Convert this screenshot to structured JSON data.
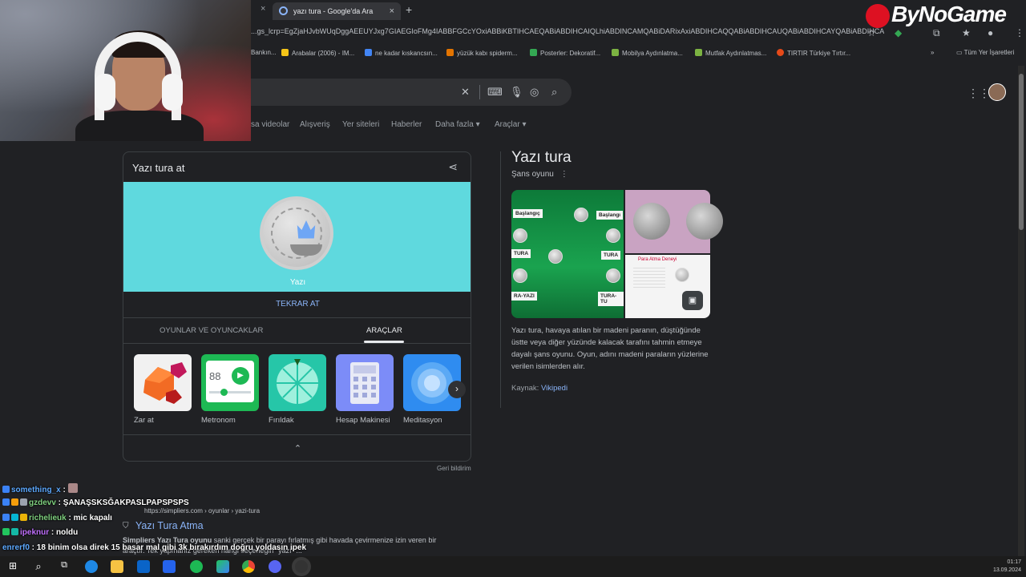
{
  "browser": {
    "tab_prev_close": "×",
    "tab_title": "yazı tura - Google'da Ara",
    "tab_close": "×",
    "new_tab": "+",
    "url": "...gs_lcrp=EgZjaHJvbWUqDggAEEUYJxg7GIAEGIoFMg4IABBFGCcYOxiABBiKBTIHCAEQABiABDIHCAIQLhiABDINCAMQABiDARixAxiABDIHCAQQABiABDIHCAUQABiABDIHCAYQABiABDIHCA...",
    "bookmarks": [
      {
        "label": "Bankın...",
        "color": "#4a4a4a"
      },
      {
        "label": "Arabalar (2006) - IM...",
        "color": "#f5c518"
      },
      {
        "label": "ne kadar kıskancsın...",
        "color": "#4285f4"
      },
      {
        "label": "yüzük kabı spiderm...",
        "color": "#e37400"
      },
      {
        "label": "Posterler: Dekoratif...",
        "color": "#34a853"
      },
      {
        "label": "Mobilya Aydınlatma...",
        "color": "#7cb342"
      },
      {
        "label": "Mutfak Aydınlatmas...",
        "color": "#7cb342"
      },
      {
        "label": "TIRTIR Türkiye Tırtır...",
        "color": "#e64a19"
      }
    ],
    "bookmarks_more": "»",
    "bookmarks_folder": "Tüm Yer İşaretleri"
  },
  "overlay": {
    "brand": "ByNoGame"
  },
  "search": {
    "clear": "✕",
    "nav_tabs": [
      "sa videolar",
      "Alışveriş",
      "Yer siteleri",
      "Haberler",
      "Daha fazla ▾",
      "Araçlar ▾"
    ]
  },
  "card": {
    "title": "Yazı tura at",
    "coin_result": "Yazı",
    "retry": "TEKRAR AT",
    "category_tabs": [
      "OYUNLAR VE OYUNCAKLAR",
      "ARAÇLAR"
    ],
    "tools": [
      {
        "label": "Zar at",
        "icon": "dice-icon"
      },
      {
        "label": "Metronom",
        "icon": "metronome-icon"
      },
      {
        "label": "Fırıldak",
        "icon": "spinner-icon"
      },
      {
        "label": "Hesap Makinesi",
        "icon": "calculator-icon"
      },
      {
        "label": "Meditasyon",
        "icon": "meditation-icon"
      }
    ],
    "metronome_value": "88",
    "next": "›",
    "collapse": "⌃",
    "feedback": "Geri bildirim"
  },
  "knowledge_panel": {
    "title": "Yazı tura",
    "subtitle": "Şans oyunu",
    "image_labels": [
      "Başlangıç",
      "Başlangı",
      "TURA",
      "TURA",
      "RA-YAZI",
      "TURA-TU"
    ],
    "image3_title": "Para Atma Deneyi",
    "description": "Yazı tura, havaya atılan bir madeni paranın, düştüğünde üstte veya diğer yüzünde kalacak tarafını tahmin etmeye dayalı şans oyunu. Oyun, adını madeni paraların yüzlerine verilen isimlerden alır.",
    "source_label": "Kaynak:",
    "source_link": "Vikipedi"
  },
  "result": {
    "url": "https://simpliers.com › oyunlar › yazi-tura",
    "title": "Yazı Tura Atma",
    "snippet_bold": "Simpliers Yazı Tura oyunu",
    "snippet": " sanki gerçek bir parayı fırlatmış gibi havada çevirmenize izin veren bir araçtır. Tek yapmanız gereken hangi seçeneğin \"yazı\" ..."
  },
  "chat": [
    {
      "user": "something_x",
      "user_color": "#5da9ff",
      "message": " :"
    },
    {
      "user": "gzdevv",
      "user_color": "#7fd07f",
      "message": " : ŞANAŞSKSĞAKPASLPAPSPSPS"
    },
    {
      "user": "richelieuk",
      "user_color": "#7fd07f",
      "message": " : mic kapalı"
    },
    {
      "user": "ipeknur",
      "user_color": "#c070ff",
      "message": " : noldu"
    },
    {
      "user": "enrerf0",
      "user_color": "#5da9ff",
      "message": " : 18 binim olsa direk 15 basar mal gibi 3k bırakırdım doğru yoldasın ipek"
    }
  ],
  "taskbar": {
    "time": "01:17",
    "date": "13.09.2024"
  }
}
